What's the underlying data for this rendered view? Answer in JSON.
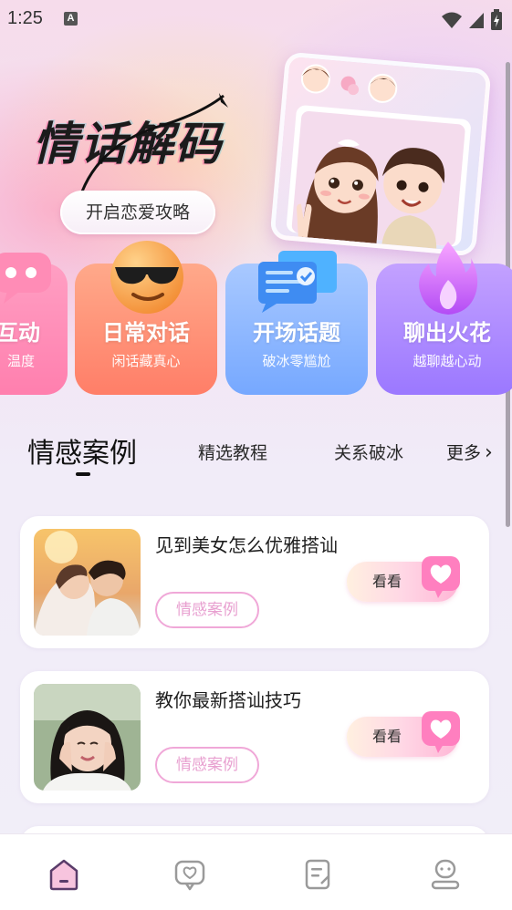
{
  "status_bar": {
    "time": "1:25",
    "notification_badge": "A",
    "icons": [
      "wifi-icon",
      "signal-icon",
      "battery-icon"
    ]
  },
  "banner": {
    "title": "情话解码",
    "cta_label": "开启恋爱攻略"
  },
  "categories": [
    {
      "title": "互动",
      "subtitle": "温度",
      "icon": "chat-bubble-icon",
      "color": "#ff8fb8"
    },
    {
      "title": "日常对话",
      "subtitle": "闲话藏真心",
      "icon": "sunglasses-emoji-icon",
      "color": "#ff8e74"
    },
    {
      "title": "开场话题",
      "subtitle": "破冰零尴尬",
      "icon": "message-document-icon",
      "color": "#88b4ff"
    },
    {
      "title": "聊出火花",
      "subtitle": "越聊越心动",
      "icon": "fire-icon",
      "color": "#ae8cff"
    }
  ],
  "tabs": {
    "items": [
      "情感案例",
      "精选教程",
      "关系破冰"
    ],
    "active_index": 0,
    "more_label": "更多"
  },
  "cards": [
    {
      "title": "见到美女怎么优雅搭讪",
      "tag": "情感案例",
      "button_label": "看看"
    },
    {
      "title": "教你最新搭讪技巧",
      "tag": "情感案例",
      "button_label": "看看"
    }
  ],
  "bottom_nav": {
    "items": [
      "home-icon",
      "chat-heart-icon",
      "notes-icon",
      "profile-icon"
    ],
    "active_index": 0,
    "active_color": "#e27fb6"
  }
}
